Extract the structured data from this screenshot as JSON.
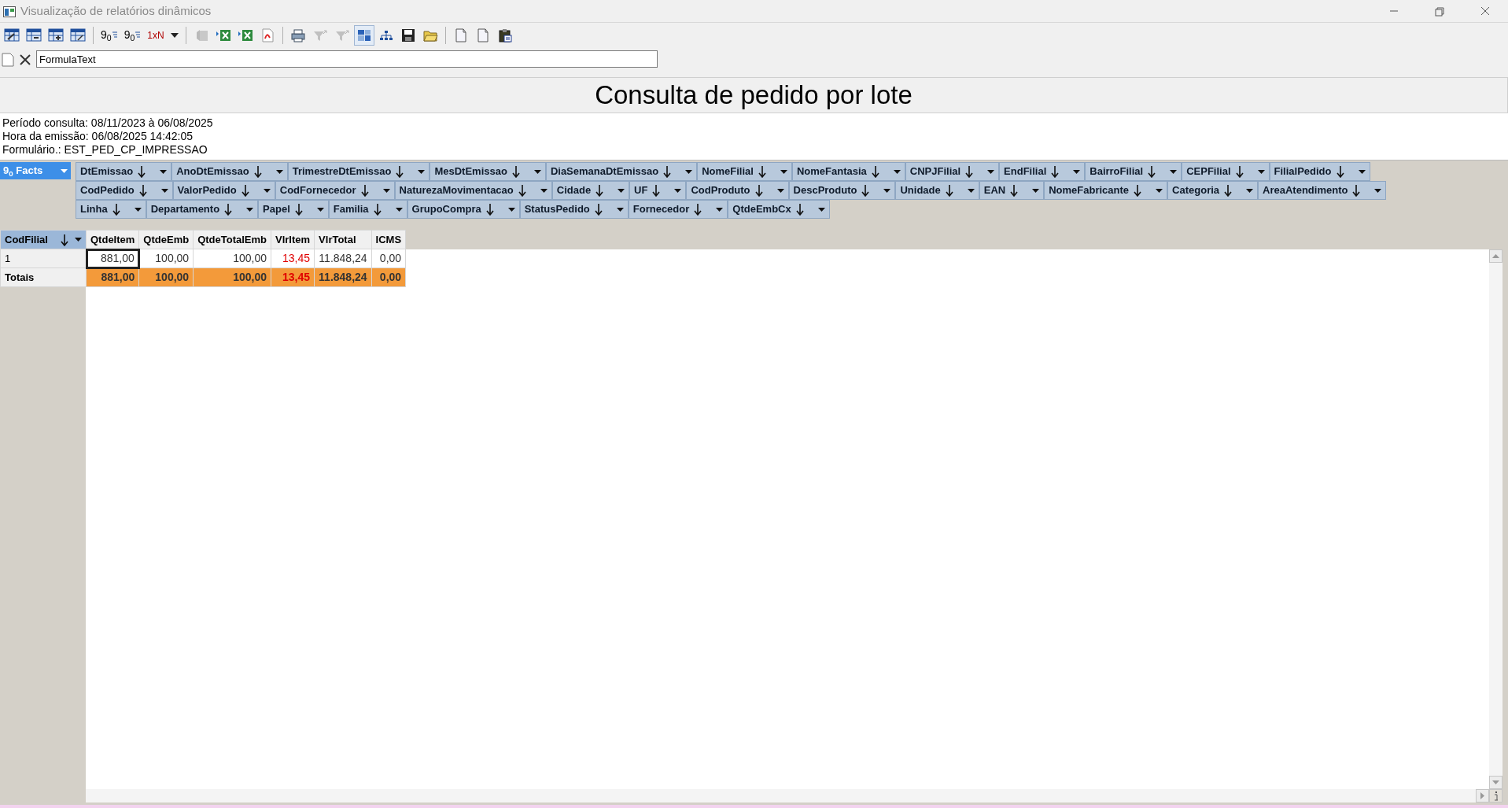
{
  "window": {
    "title": "Visualização de relatórios dinâmicos"
  },
  "toolbar": [
    {
      "kind": "icon",
      "disabled": false,
      "pressed": false
    },
    {
      "kind": "icon",
      "disabled": false,
      "pressed": false
    },
    {
      "kind": "icon",
      "disabled": false,
      "pressed": false
    },
    {
      "kind": "icon",
      "disabled": false,
      "pressed": false
    },
    {
      "kind": "separator"
    },
    {
      "kind": "text",
      "label": "9$_{0}$",
      "disabled": false,
      "pressed": false
    },
    {
      "kind": "text",
      "label": "9$_{0}$",
      "disabled": false,
      "pressed": false
    },
    {
      "kind": "dropdown",
      "label": "1xN",
      "disabled": false,
      "pressed": false
    },
    {
      "kind": "separator"
    },
    {
      "kind": "icon",
      "disabled": true,
      "pressed": false
    },
    {
      "kind": "icon",
      "disabled": false,
      "pressed": false
    },
    {
      "kind": "icon",
      "disabled": false,
      "pressed": false
    },
    {
      "kind": "icon",
      "disabled": false,
      "pressed": false
    },
    {
      "kind": "separator"
    },
    {
      "kind": "icon",
      "disabled": false,
      "pressed": false
    },
    {
      "kind": "icon",
      "disabled": true,
      "pressed": false
    },
    {
      "kind": "icon",
      "disabled": true,
      "pressed": false
    },
    {
      "kind": "icon",
      "disabled": false,
      "pressed": true
    },
    {
      "kind": "icon",
      "disabled": false,
      "pressed": false
    },
    {
      "kind": "icon",
      "disabled": false,
      "pressed": false
    },
    {
      "kind": "icon",
      "disabled": false,
      "pressed": false
    },
    {
      "kind": "separator"
    },
    {
      "kind": "icon",
      "disabled": false,
      "pressed": false
    },
    {
      "kind": "icon",
      "disabled": false,
      "pressed": false
    },
    {
      "kind": "icon",
      "disabled": false,
      "pressed": false
    }
  ],
  "formula_bar": {
    "value": "FormulaText"
  },
  "report": {
    "title": "Consulta de pedido por lote",
    "info": [
      "Período consulta: 08/11/2023 à 06/08/2025",
      "Hora da emissão: 06/08/2025 14:42:05",
      "Formulário.: EST_PED_CP_IMPRESSAO"
    ]
  },
  "facts_button": {
    "label": "9$_{0}$ Facts"
  },
  "field_rows": [
    [
      "DtEmissao",
      "AnoDtEmissao",
      "TrimestreDtEmissao",
      "MesDtEmissao",
      "DiaSemanaDtEmissao",
      "NomeFilial",
      "NomeFantasia",
      "CNPJFilial",
      "EndFilial",
      "BairroFilial",
      "CEPFilial",
      "FilialPedido"
    ],
    [
      "CodPedido",
      "ValorPedido",
      "CodFornecedor",
      "NaturezaMovimentacao",
      "Cidade",
      "UF",
      "CodProduto",
      "DescProduto",
      "Unidade",
      "EAN",
      "NomeFabricante",
      "Categoria",
      "AreaAtendimento"
    ],
    [
      "Linha",
      "Departamento",
      "Papel",
      "Familia",
      "GrupoCompra",
      "StatusPedido",
      "Fornecedor",
      "QtdeEmbCx"
    ]
  ],
  "table": {
    "row_field": "CodFilial",
    "columns": [
      {
        "label": "QtdeItem",
        "color": "#333333"
      },
      {
        "label": "QtdeEmb",
        "color": "#333333"
      },
      {
        "label": "QtdeTotalEmb",
        "color": "#333333"
      },
      {
        "label": "VlrItem",
        "color": "#e00000"
      },
      {
        "label": "VlrTotal",
        "color": "#333333"
      },
      {
        "label": "ICMS",
        "color": "#333333"
      }
    ],
    "rows": [
      {
        "kind": "data",
        "label": "1",
        "cells": [
          {
            "text": "881,00",
            "focused": true
          },
          {
            "text": "100,00",
            "focused": false
          },
          {
            "text": "100,00",
            "focused": false
          },
          {
            "text": "13,45",
            "focused": false
          },
          {
            "text": "11.848,24",
            "focused": false
          },
          {
            "text": "0,00",
            "focused": false
          }
        ]
      },
      {
        "kind": "total",
        "label": "Totais",
        "cells": [
          {
            "text": "881,00",
            "focused": false
          },
          {
            "text": "100,00",
            "focused": false
          },
          {
            "text": "100,00",
            "focused": false
          },
          {
            "text": "13,45",
            "focused": false
          },
          {
            "text": "11.848,24",
            "focused": false
          },
          {
            "text": "0,00",
            "focused": false
          }
        ]
      }
    ]
  }
}
